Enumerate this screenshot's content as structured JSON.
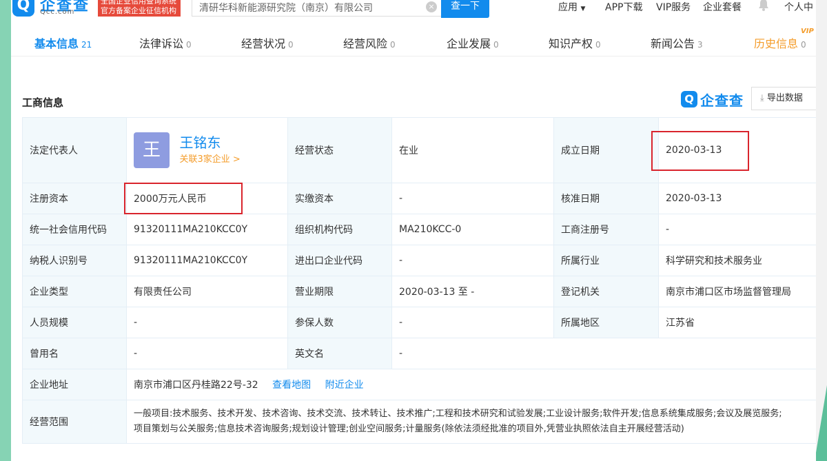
{
  "header": {
    "logo_glyph": "Q",
    "logo_text": "企查查",
    "logo_sub": "Qcc.com",
    "badge_text": "全国企业信用查询系统官方备案企业征信机构",
    "search_value": "清研华科新能源研究院（南京）有限公司",
    "search_button": "查一下",
    "nav": [
      "应用",
      "APP下载",
      "VIP服务",
      "企业套餐",
      "个人中"
    ]
  },
  "tabs": [
    {
      "label": "基本信息",
      "count": "21"
    },
    {
      "label": "法律诉讼",
      "count": "0"
    },
    {
      "label": "经营状况",
      "count": "0"
    },
    {
      "label": "经营风险",
      "count": "0"
    },
    {
      "label": "企业发展",
      "count": "0"
    },
    {
      "label": "知识产权",
      "count": "0"
    },
    {
      "label": "新闻公告",
      "count": "3"
    },
    {
      "label": "历史信息",
      "count": "0"
    }
  ],
  "vip_mark": "VIP",
  "section": {
    "title": "工商信息",
    "brand_glyph": "Q",
    "brand": "企查查",
    "export_label": "导出数据"
  },
  "legal_rep": {
    "label": "法定代表人",
    "avatar_char": "王",
    "name": "王铭东",
    "related": "关联3家企业 >"
  },
  "rows": {
    "status_label": "经营状态",
    "status": "在业",
    "founded_label": "成立日期",
    "founded": "2020-03-13",
    "reg_capital_label": "注册资本",
    "reg_capital": "2000万元人民币",
    "paid_capital_label": "实缴资本",
    "paid_capital": "-",
    "approved_label": "核准日期",
    "approved": "2020-03-13",
    "credit_code_label": "统一社会信用代码",
    "credit_code": "91320111MA210KCC0Y",
    "org_code_label": "组织机构代码",
    "org_code": "MA210KCC-0",
    "biz_reg_label": "工商注册号",
    "biz_reg": "-",
    "taxpayer_label": "纳税人识别号",
    "taxpayer": "91320111MA210KCC0Y",
    "import_code_label": "进出口企业代码",
    "import_code": "-",
    "industry_label": "所属行业",
    "industry": "科学研究和技术服务业",
    "type_label": "企业类型",
    "type": "有限责任公司",
    "term_label": "营业期限",
    "term": "2020-03-13 至 -",
    "authority_label": "登记机关",
    "authority": "南京市浦口区市场监督管理局",
    "staff_label": "人员规模",
    "staff": "-",
    "insured_label": "参保人数",
    "insured": "-",
    "region_label": "所属地区",
    "region": "江苏省",
    "former_label": "曾用名",
    "former": "-",
    "english_label": "英文名",
    "english": "-",
    "address_label": "企业地址",
    "address": "南京市浦口区丹桂路22号-32",
    "map_link": "查看地图",
    "nearby_link": "附近企业",
    "scope_label": "经营范围",
    "scope_line1": "一般项目:技术服务、技术开发、技术咨询、技术交流、技术转让、技术推广;工程和技术研究和试验发展;工业设计服务;软件开发;信息系统集成服务;会议及展览服务;",
    "scope_line2": "项目策划与公关服务;信息技术咨询服务;规划设计管理;创业空间服务;计量服务(除依法须经批准的项目外,凭营业执照依法自主开展经营活动)"
  },
  "colors": {
    "accent": "#128bed",
    "orange": "#f49c2a",
    "highlight": "#d9242c",
    "label_bg": "#f2f9fc"
  }
}
